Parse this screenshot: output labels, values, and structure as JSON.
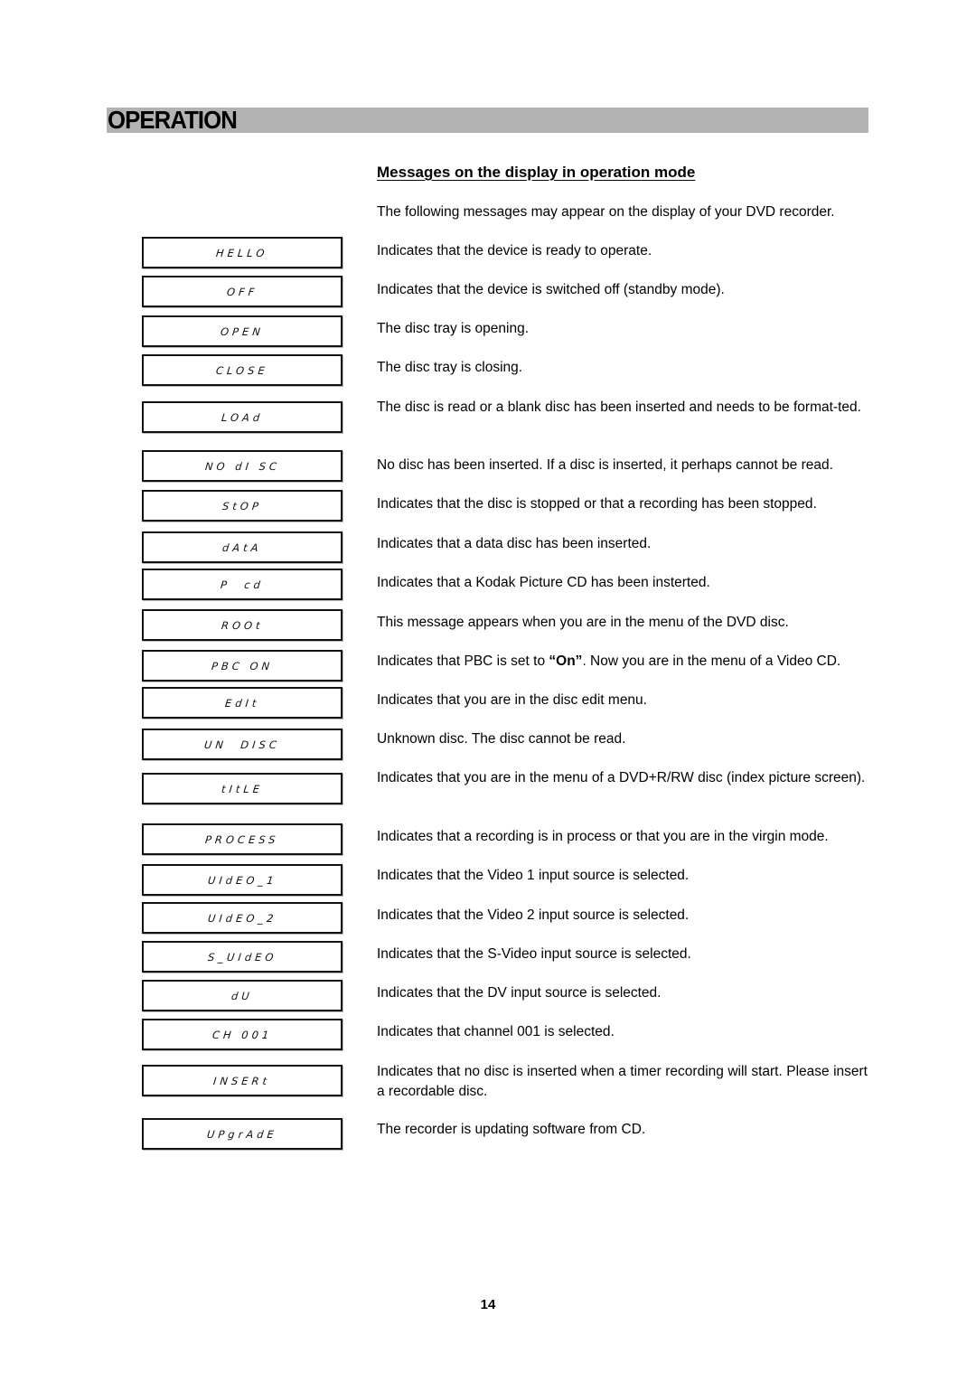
{
  "section": {
    "title": "OPERATION",
    "bar_color": "#b3b3b3"
  },
  "subheading": "Messages on the display in operation mode",
  "intro": "The following messages may appear on the display of your DVD recorder.",
  "messages": [
    {
      "display": "HELLO",
      "description": "Indicates that the device is ready to operate."
    },
    {
      "display": "OFF",
      "description": "Indicates that the device is switched off (standby mode)."
    },
    {
      "display": "OPEN",
      "description": "The disc tray is opening."
    },
    {
      "display": "CLOSE",
      "description": "The disc tray is closing."
    },
    {
      "display": "LOAd",
      "description": "The disc is read or a blank disc has been inserted and needs to be format-ted."
    },
    {
      "display": "NO dI SC",
      "description": "No disc has been inserted. If a disc is inserted, it perhaps cannot be read."
    },
    {
      "display": "StOP",
      "description": "Indicates that the disc is stopped or that a recording has been stopped."
    },
    {
      "display": "dAtA",
      "description": "Indicates that a data disc has been inserted."
    },
    {
      "display": "P  cd",
      "description": "Indicates that a Kodak Picture CD has been insterted."
    },
    {
      "display": "ROOt",
      "description": "This message appears when you are in the menu of the DVD disc."
    },
    {
      "display": "PBC ON",
      "description_pre": "Indicates that PBC is set to ",
      "description_bold": "“On”",
      "description_post": ". Now you are in the menu of a Video CD."
    },
    {
      "display": "EdIt",
      "description": "Indicates that you are in the disc edit menu."
    },
    {
      "display": "UN  DISC",
      "description": "Unknown disc. The disc cannot be read."
    },
    {
      "display": "tItLE",
      "description": "Indicates that you are in the menu of a DVD+R/RW disc (index picture screen)."
    },
    {
      "display": "PROCESS",
      "description": "Indicates that a recording is in process or that you are in the virgin mode."
    },
    {
      "display": "UIdEO_1",
      "description": "Indicates that the Video 1 input source is selected."
    },
    {
      "display": "UIdEO_2",
      "description": "Indicates that the Video 2 input source is selected."
    },
    {
      "display": "S_UIdEO",
      "description": "Indicates that the S-Video input source is selected."
    },
    {
      "display": "dU",
      "description": "Indicates that the DV input source is selected."
    },
    {
      "display": "CH 001",
      "description": "Indicates that channel 001 is selected."
    },
    {
      "display": "INSERt",
      "description": "Indicates that no disc is inserted when a timer recording will start. Please insert a recordable disc."
    },
    {
      "display": "UPgrAdE",
      "description": "The recorder is updating software from CD."
    }
  ],
  "page_number": "14"
}
